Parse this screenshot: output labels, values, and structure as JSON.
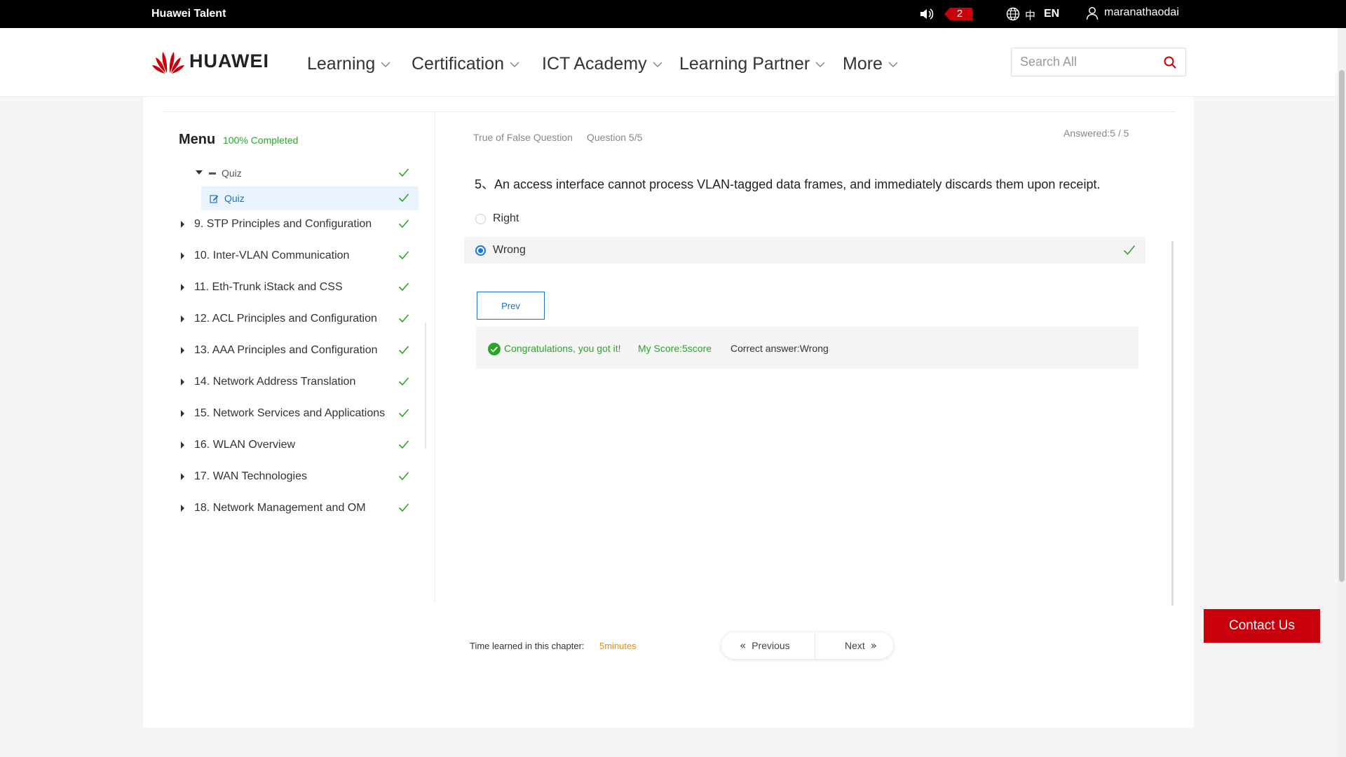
{
  "topbar": {
    "brand": "Huawei Talent",
    "message_count": "2",
    "lang_zh": "中",
    "lang_en": "EN",
    "username": "maranathaodai"
  },
  "nav": {
    "logo_text": "HUAWEI",
    "items": [
      {
        "label": "Learning"
      },
      {
        "label": "Certification"
      },
      {
        "label": "ICT Academy"
      },
      {
        "label": "Learning Partner"
      },
      {
        "label": "More"
      }
    ],
    "search_placeholder": "Search All"
  },
  "sidebar": {
    "title": "Menu",
    "progress": "100% Completed",
    "quiz_parent": "Quiz",
    "quiz_child": "Quiz",
    "chapters": [
      {
        "label": "9. STP Principles and Configuration",
        "completed": true
      },
      {
        "label": "10. Inter-VLAN Communication",
        "completed": true
      },
      {
        "label": "11. Eth-Trunk iStack and CSS",
        "completed": true
      },
      {
        "label": "12. ACL Principles and Configuration",
        "completed": true
      },
      {
        "label": "13. AAA Principles and Configuration",
        "completed": true
      },
      {
        "label": "14. Network Address Translation",
        "completed": true
      },
      {
        "label": "15. Network Services and Applications",
        "completed": true
      },
      {
        "label": "16. WLAN Overview",
        "completed": true
      },
      {
        "label": "17. WAN Technologies",
        "completed": true
      },
      {
        "label": "18. Network Management and OM",
        "completed": true
      }
    ]
  },
  "question": {
    "type": "True of False Question",
    "number": "Question 5/5",
    "answered": "Answered:5 / 5",
    "text": "5、An access interface cannot process VLAN-tagged data frames, and immediately discards them upon receipt.",
    "options": [
      {
        "label": "Right",
        "selected": false
      },
      {
        "label": "Wrong",
        "selected": true
      }
    ],
    "prev_label": "Prev",
    "result": {
      "congrats": "Congratulations, you got it!",
      "score": "My Score:5score",
      "correct": "Correct answer:Wrong"
    }
  },
  "footer": {
    "time_label": "Time learned in this chapter:",
    "time_value": "5minutes",
    "previous": "Previous",
    "next": "Next",
    "contact": "Contact Us"
  },
  "colors": {
    "brand_red": "#c7000b",
    "success_green": "#2aa52a",
    "link_blue": "#1a73c6",
    "time_orange": "#f08c00"
  }
}
